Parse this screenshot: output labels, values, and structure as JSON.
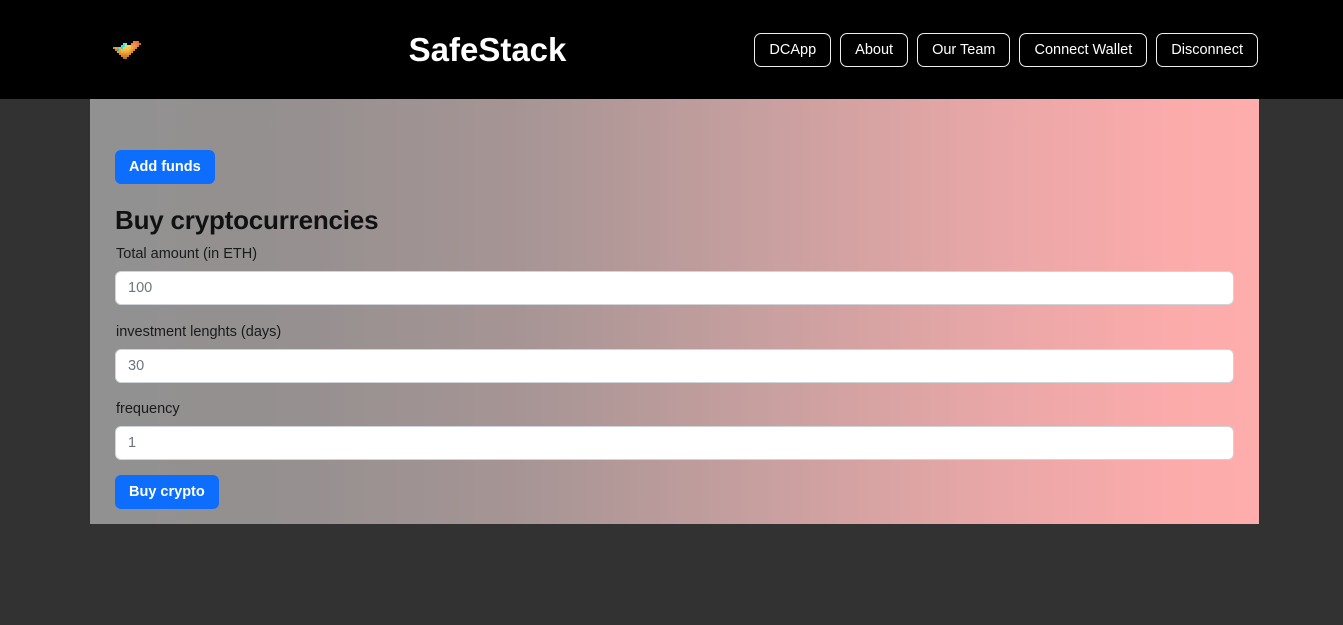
{
  "navbar": {
    "logo_icon": "pixel-bird-logo-icon",
    "brand_title": "SafeStack",
    "links": [
      {
        "label": "DCApp"
      },
      {
        "label": "About"
      },
      {
        "label": "Our Team"
      },
      {
        "label": "Connect Wallet"
      },
      {
        "label": "Disconnect"
      }
    ]
  },
  "main": {
    "add_funds_label": "Add funds",
    "section_title": "Buy cryptocurrencies",
    "fields": [
      {
        "label": "Total amount (in ETH)",
        "placeholder": "100",
        "value": ""
      },
      {
        "label": "investment lenghts (days)",
        "placeholder": "30",
        "value": ""
      },
      {
        "label": "frequency",
        "placeholder": "1",
        "value": ""
      }
    ],
    "buy_label": "Buy crypto"
  },
  "colors": {
    "navbar_bg": "#000000",
    "page_bg": "#323232",
    "primary_button": "#0d6efd",
    "panel_gradient_start": "#919191",
    "panel_gradient_end": "#feadad",
    "input_bg": "#ffffff",
    "placeholder_text": "#6e757c"
  }
}
